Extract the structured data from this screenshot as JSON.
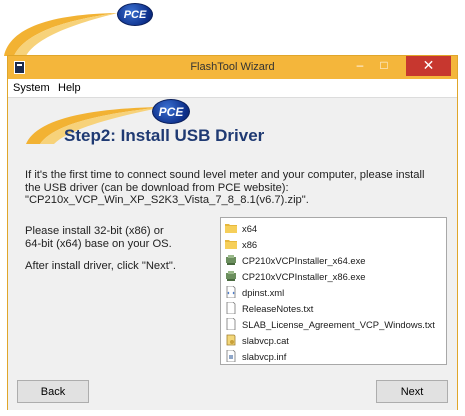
{
  "logo_text": "PCE",
  "window": {
    "title": "FlashTool Wizard",
    "close_glyph": "✕",
    "minimize_glyph": "–",
    "maximize_glyph": "□",
    "accent_color": "#f4b63b"
  },
  "menu": [
    "System",
    "Help"
  ],
  "step_title": "Step2: Install USB Driver",
  "info_lines": [
    "If it's the first time to connect sound level meter and your computer, please install",
    "the USB driver (can be download from PCE website):",
    "\"CP210x_VCP_Win_XP_S2K3_Vista_7_8_8.1(v6.7).zip\"."
  ],
  "instruction_lines": [
    "Please install 32-bit (x86) or",
    "64-bit (x64) base on your OS."
  ],
  "after_install_text": "After install driver, click \"Next\".",
  "files": [
    {
      "name": "x64",
      "icon": "folder-icon"
    },
    {
      "name": "x86",
      "icon": "folder-icon"
    },
    {
      "name": "CP210xVCPInstaller_x64.exe",
      "icon": "installer-icon"
    },
    {
      "name": "CP210xVCPInstaller_x86.exe",
      "icon": "installer-icon"
    },
    {
      "name": "dpinst.xml",
      "icon": "xml-file-icon"
    },
    {
      "name": "ReleaseNotes.txt",
      "icon": "text-file-icon"
    },
    {
      "name": "SLAB_License_Agreement_VCP_Windows.txt",
      "icon": "text-file-icon"
    },
    {
      "name": "slabvcp.cat",
      "icon": "catalog-file-icon"
    },
    {
      "name": "slabvcp.inf",
      "icon": "inf-file-icon"
    }
  ],
  "buttons": {
    "back": "Back",
    "next": "Next"
  }
}
